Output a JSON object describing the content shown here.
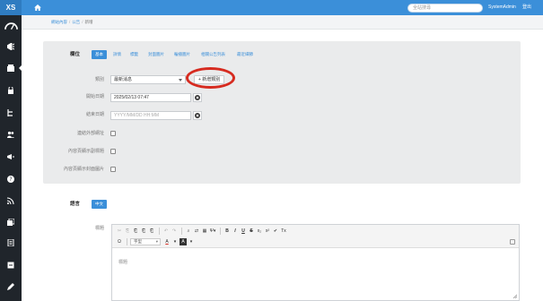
{
  "topbar": {
    "brand": "XS",
    "search_placeholder": "全站搜尋",
    "user_name": "SystemAdmin",
    "logout_label": "登出"
  },
  "breadcrumb": {
    "items": [
      "網站內容",
      "公告",
      "新增"
    ]
  },
  "tabs": [
    "基本",
    "詳情",
    "標籤",
    "封面圖片",
    "輪播圖片",
    "相關公告列表",
    "最近細節"
  ],
  "form": {
    "section_label": "欄位",
    "category_label": "類別",
    "category_value": "最新消息",
    "add_category_label": "+ 新增類別",
    "start_label": "開始日期",
    "start_value": "2025/02/13 07:47",
    "end_label": "結束日期",
    "end_placeholder": "YYYY/MM/DD HH:MM",
    "external_label": "連結外部網址",
    "show_subtitle_label": "內容頁顯示副標題",
    "show_cover_label": "內容頁顯示封面圖片"
  },
  "language": {
    "section_label": "語言",
    "active_tab": "中文"
  },
  "editor": {
    "field_label": "標題",
    "toolbar_row1": [
      "✂",
      "⎘",
      "⎗",
      "⎗",
      "⎗",
      "↶",
      "↷",
      "⌕",
      "⇄",
      "▦",
      "Ψ▾",
      "B",
      "I",
      "U",
      "S",
      "x₂",
      "x²",
      "✔",
      "Tx"
    ],
    "font_combo": "字型",
    "text_color_label": "A",
    "bg_color_label": "A",
    "omega_label": "Ω",
    "body_placeholder": "標題"
  },
  "colors": {
    "accent": "#3b8fd9",
    "sidebar": "#20252b",
    "highlight": "#d62b20"
  }
}
